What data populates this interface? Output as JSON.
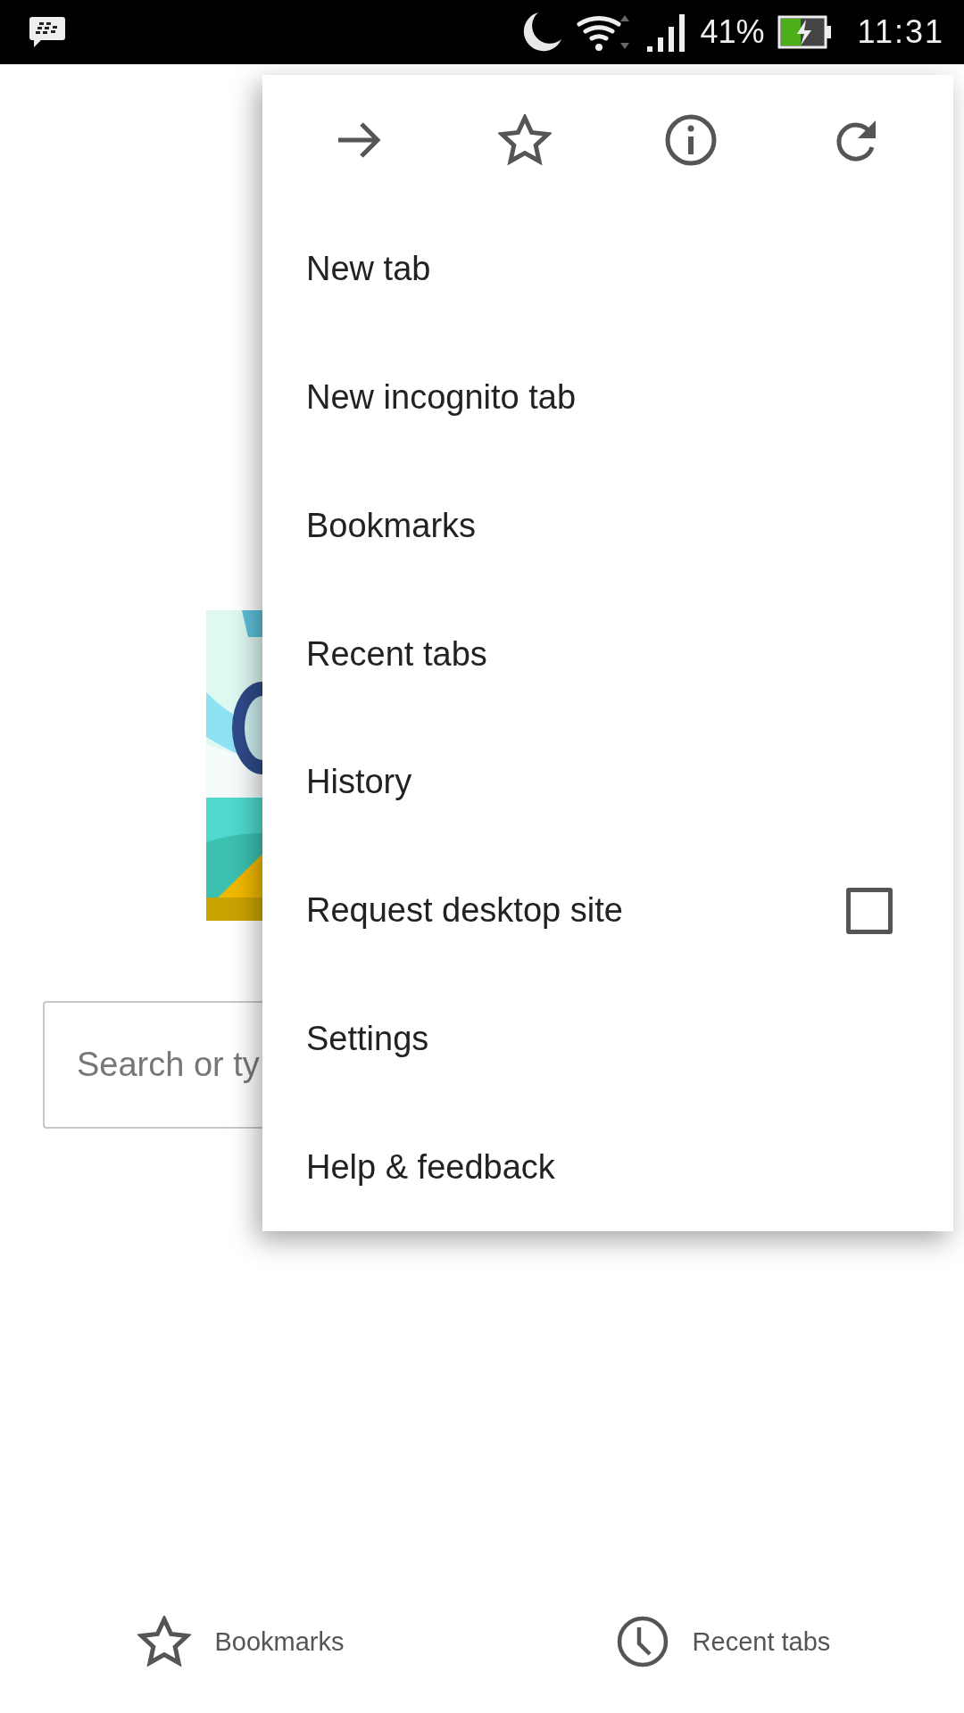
{
  "status_bar": {
    "battery": "41%",
    "time": "11:31"
  },
  "page": {
    "search": {
      "placeholder": "Search or ty"
    },
    "bottom_links": [
      {
        "label": "Bookmarks",
        "kind": "bookmarks"
      },
      {
        "label": "Recent tabs",
        "kind": "recent"
      }
    ]
  },
  "menu": {
    "items": [
      {
        "label": "New tab",
        "kind": "plain"
      },
      {
        "label": "New incognito tab",
        "kind": "plain"
      },
      {
        "label": "Bookmarks",
        "kind": "plain"
      },
      {
        "label": "Recent tabs",
        "kind": "plain"
      },
      {
        "label": "History",
        "kind": "plain"
      },
      {
        "label": "Request desktop site",
        "kind": "checkbox",
        "checked": false
      },
      {
        "label": "Settings",
        "kind": "plain"
      },
      {
        "label": "Help & feedback",
        "kind": "plain"
      }
    ]
  }
}
